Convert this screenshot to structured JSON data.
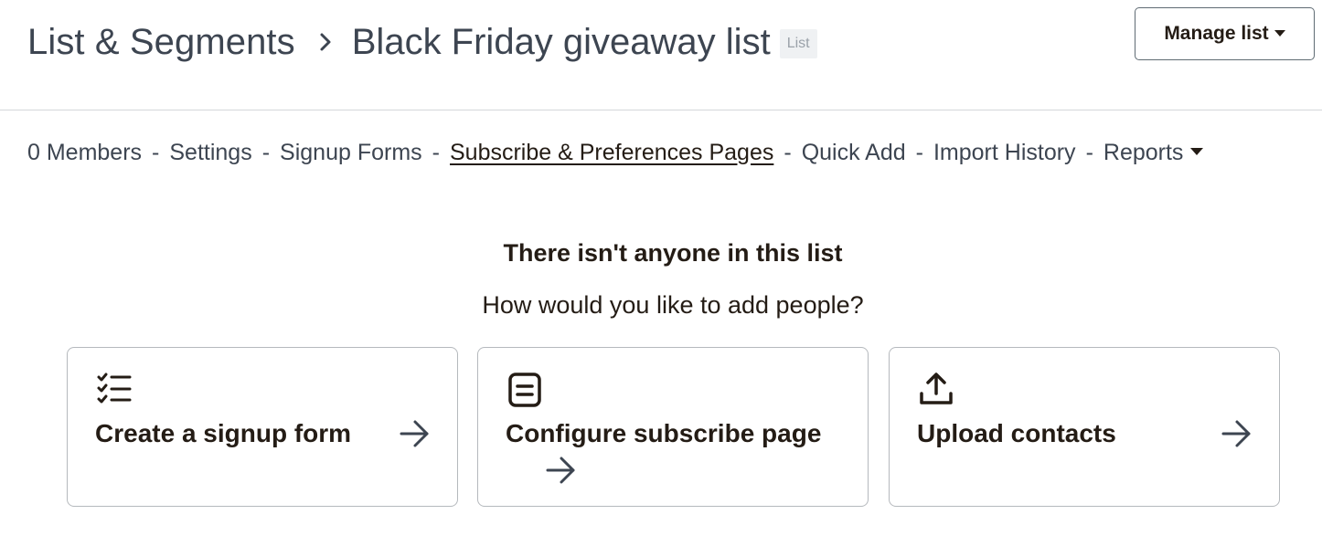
{
  "header": {
    "breadcrumb_root": "List & Segments",
    "current_list": "Black Friday giveaway list",
    "list_tag": "List",
    "manage_label": "Manage list"
  },
  "subnav": {
    "items": [
      {
        "label": "0 Members"
      },
      {
        "label": "Settings"
      },
      {
        "label": "Signup Forms"
      },
      {
        "label": "Subscribe & Preferences Pages",
        "active": true
      },
      {
        "label": "Quick Add"
      },
      {
        "label": "Import History"
      },
      {
        "label": "Reports"
      }
    ],
    "separator": "-"
  },
  "empty_state": {
    "title": "There isn't anyone in this list",
    "subtitle": "How would you like to add people?"
  },
  "cards": [
    {
      "title": "Create a signup form",
      "icon": "checklist-icon"
    },
    {
      "title": "Configure subscribe page",
      "icon": "form-icon"
    },
    {
      "title": "Upload contacts",
      "icon": "upload-icon"
    }
  ]
}
